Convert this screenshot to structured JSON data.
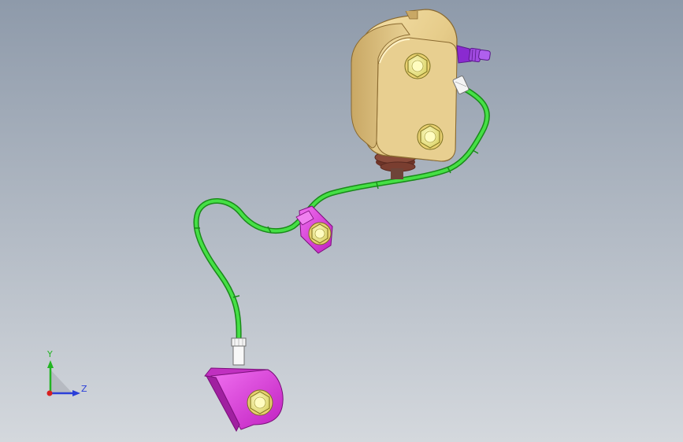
{
  "viewport": {
    "background_top": "#8e9aaa",
    "background_bottom": "#d4d8dd"
  },
  "model": {
    "housing_color": "#e6cc8a",
    "housing_shadow": "#b8995a",
    "tube_color": "#35d835",
    "tube_outline": "#1a8a1a",
    "bracket_color": "#e040e0",
    "bracket_dark": "#a020a0",
    "bolt_color": "#f4f08a",
    "bellows_color": "#8a4a3a",
    "fitting_color": "#9a3ad8",
    "nut_color": "#f2f2f2"
  },
  "triad": {
    "y_label": "Y",
    "z_label": "Z",
    "y_color": "#22b422",
    "z_color": "#2a3fd8",
    "x_color": "#d82020"
  }
}
